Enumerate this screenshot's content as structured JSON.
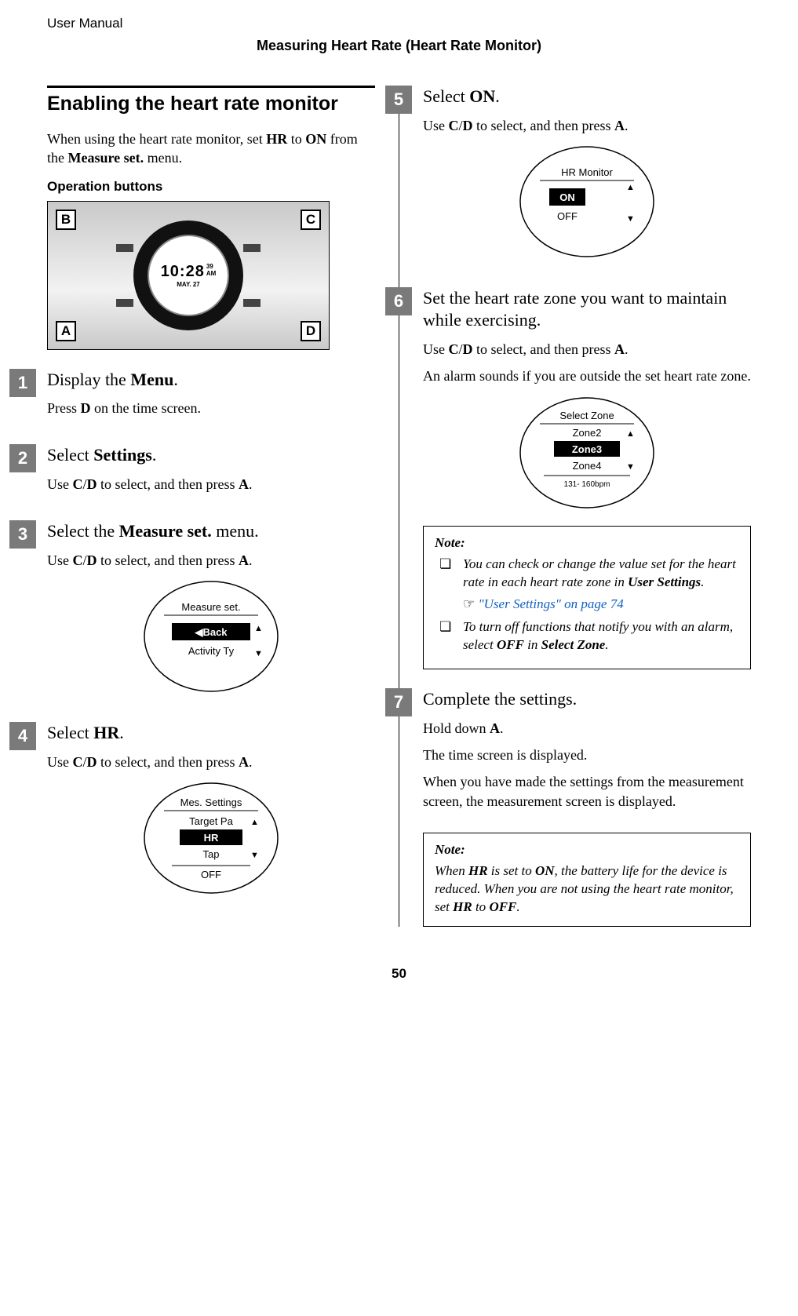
{
  "header": {
    "doc_title": "User Manual",
    "section": "Measuring Heart Rate (Heart Rate Monitor)"
  },
  "main_title": "Enabling the heart rate monitor",
  "intro_pre": "When using the heart rate monitor, set ",
  "intro_b1": "HR",
  "intro_mid": " to ",
  "intro_b2": "ON",
  "intro_mid2": " from the ",
  "intro_b3": "Measure set.",
  "intro_post": " menu.",
  "op_buttons": "Operation buttons",
  "watch": {
    "time_main": "10:28",
    "time_sec": "39",
    "time_ampm": "AM",
    "date": "MAY. 27",
    "B": "B",
    "C": "C",
    "A": "A",
    "D": "D"
  },
  "steps": {
    "1": {
      "num": "1",
      "title_pre": "Display the ",
      "title_b": "Menu",
      "title_post": ".",
      "text_pre": "Press ",
      "text_b": "D",
      "text_post": " on the time screen."
    },
    "2": {
      "num": "2",
      "title_pre": "Select ",
      "title_b": "Settings",
      "title_post": ".",
      "text_pre": "Use ",
      "text_b": "C",
      "text_mid": "/",
      "text_b2": "D",
      "text_mid2": " to select, and then press ",
      "text_b3": "A",
      "text_post": "."
    },
    "3": {
      "num": "3",
      "title_pre": "Select the ",
      "title_b": "Measure set.",
      "title_post": " menu.",
      "text_pre": "Use ",
      "text_b": "C",
      "text_mid": "/",
      "text_b2": "D",
      "text_mid2": " to select, and then press ",
      "text_b3": "A",
      "text_post": ".",
      "screen": {
        "header": "Measure set.",
        "row_sel": "Back",
        "row_below": "Activity Ty"
      }
    },
    "4": {
      "num": "4",
      "title_pre": "Select ",
      "title_b": "HR",
      "title_post": ".",
      "text_pre": "Use ",
      "text_b": "C",
      "text_mid": "/",
      "text_b2": "D",
      "text_mid2": " to select, and then press ",
      "text_b3": "A",
      "text_post": ".",
      "screen": {
        "header": "Mes. Settings",
        "row_above": "Target Pa",
        "row_sel": "HR",
        "row_below": "Tap",
        "foot": "OFF"
      }
    },
    "5": {
      "num": "5",
      "title_pre": "Select ",
      "title_b": "ON",
      "title_post": ".",
      "text_pre": "Use ",
      "text_b": "C",
      "text_mid": "/",
      "text_b2": "D",
      "text_mid2": " to select, and then press ",
      "text_b3": "A",
      "text_post": ".",
      "screen": {
        "header": "HR Monitor",
        "row_sel": "ON",
        "row_below": "OFF"
      }
    },
    "6": {
      "num": "6",
      "title": "Set the heart rate zone you want to maintain while exercising.",
      "text_pre": "Use ",
      "text_b": "C",
      "text_mid": "/",
      "text_b2": "D",
      "text_mid2": " to select, and then press ",
      "text_b3": "A",
      "text_post": ".",
      "extra": "An alarm sounds if you are outside the set heart rate zone.",
      "screen": {
        "header": "Select Zone",
        "row_above": "Zone2",
        "row_sel": "Zone3",
        "row_below": "Zone4",
        "foot": "131- 160bpm"
      }
    },
    "7": {
      "num": "7",
      "title": "Complete the settings.",
      "l1_pre": "Hold down ",
      "l1_b": "A",
      "l1_post": ".",
      "l2": "The time screen is displayed.",
      "l3": "When you have made the settings from the measurement screen, the measurement screen is displayed."
    }
  },
  "note1": {
    "title": "Note:",
    "li1_pre": "You can check or change the value set for the heart rate in each heart rate zone in ",
    "li1_b": "User Settings",
    "li1_post": ".",
    "link": "\"User Settings\" on page 74",
    "li2_pre": "To turn off functions that notify you with an alarm, select ",
    "li2_b1": "OFF",
    "li2_mid": " in ",
    "li2_b2": "Select Zone",
    "li2_post": "."
  },
  "note2": {
    "title": "Note:",
    "text_pre": "When ",
    "b1": "HR",
    "mid1": " is set to ",
    "b2": "ON",
    "mid2": ", the battery life for the device is reduced. When you are not using the heart rate monitor, set ",
    "b3": "HR",
    "mid3": " to ",
    "b4": "OFF",
    "post": "."
  },
  "page": "50"
}
